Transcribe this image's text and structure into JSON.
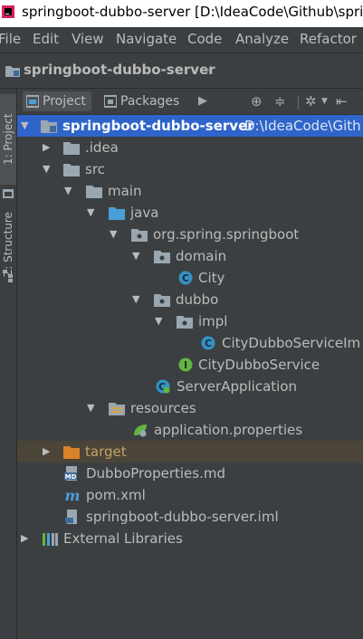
{
  "window": {
    "title": "springboot-dubbo-server [D:\\IdeaCode\\Github\\spri"
  },
  "menu": [
    "File",
    "Edit",
    "View",
    "Navigate",
    "Code",
    "Analyze",
    "Refactor"
  ],
  "breadcrumb": {
    "module": "springboot-dubbo-server"
  },
  "side_tabs": {
    "project": "1: Project",
    "structure": "Z: Structure"
  },
  "toolwindow": {
    "tabs": [
      "Project",
      "Packages"
    ]
  },
  "tree": [
    {
      "label": "springboot-dubbo-server",
      "hint": "D:\\IdeaCode\\Gith",
      "icon": "module-folder-icon",
      "expanded": true,
      "depth": 0
    },
    {
      "label": ".idea",
      "icon": "folder-icon",
      "expanded": false,
      "depth": 1
    },
    {
      "label": "src",
      "icon": "folder-icon",
      "expanded": true,
      "depth": 1
    },
    {
      "label": "main",
      "icon": "folder-icon",
      "expanded": true,
      "depth": 2
    },
    {
      "label": "java",
      "icon": "source-folder-icon",
      "expanded": true,
      "depth": 3
    },
    {
      "label": "org.spring.springboot",
      "icon": "package-icon",
      "expanded": true,
      "depth": 4
    },
    {
      "label": "domain",
      "icon": "package-icon",
      "expanded": true,
      "depth": 5
    },
    {
      "label": "City",
      "icon": "class-icon",
      "depth": 6
    },
    {
      "label": "dubbo",
      "icon": "package-icon",
      "expanded": true,
      "depth": 5
    },
    {
      "label": "impl",
      "icon": "package-icon",
      "expanded": true,
      "depth": 6
    },
    {
      "label": "CityDubboServiceIm",
      "icon": "class-icon",
      "depth": 8
    },
    {
      "label": "CityDubboService",
      "icon": "interface-icon",
      "depth": 7
    },
    {
      "label": "ServerApplication",
      "icon": "spring-boot-class-icon",
      "depth": 6
    },
    {
      "label": "resources",
      "icon": "resources-folder-icon",
      "expanded": true,
      "depth": 3
    },
    {
      "label": "application.properties",
      "icon": "spring-properties-icon",
      "depth": 5
    },
    {
      "label": "target",
      "icon": "excluded-folder-icon",
      "expanded": false,
      "depth": 1
    },
    {
      "label": "DubboProperties.md",
      "icon": "markdown-file-icon",
      "depth": 2
    },
    {
      "label": "pom.xml",
      "icon": "maven-icon",
      "depth": 2
    },
    {
      "label": "springboot-dubbo-server.iml",
      "icon": "iml-file-icon",
      "depth": 2
    },
    {
      "label": "External Libraries",
      "icon": "libraries-icon",
      "expanded": false,
      "depth": 0
    }
  ],
  "colors": {
    "background": "#3c3f41",
    "selected_row": "#2f65ca",
    "excluded_row": "#4a4538",
    "folder": "#9aa7b0",
    "source_folder": "#4a9fd8",
    "class": "#3592c4",
    "interface": "#62b543",
    "excluded_folder": "#d9822b"
  }
}
